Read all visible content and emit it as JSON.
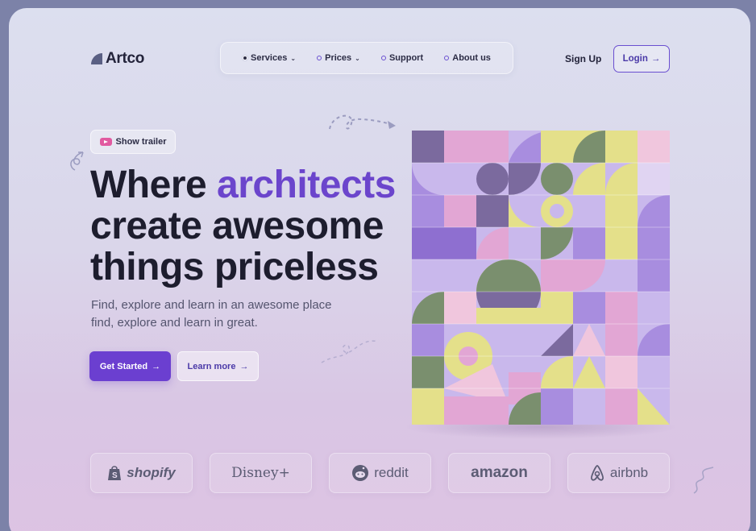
{
  "header": {
    "logo_text": "Artco",
    "nav": [
      {
        "label": "Services",
        "chevron": true
      },
      {
        "label": "Prices",
        "chevron": true
      },
      {
        "label": "Support",
        "chevron": false
      },
      {
        "label": "About us",
        "chevron": false
      }
    ],
    "signup_label": "Sign Up",
    "login_label": "Login",
    "login_arrow": "→"
  },
  "hero": {
    "trailer_label": "Show trailer",
    "headline_line1_a": "Where ",
    "headline_line1_accent": "architects",
    "headline_line2": "create awesome",
    "headline_line3": "things priceless",
    "subtitle_line1": "Find, explore and learn in an awesome place",
    "subtitle_line2": "find, explore and learn in great.",
    "primary_label": "Get Started",
    "secondary_label": "Learn more",
    "arrow": "→"
  },
  "brands": [
    "shopify",
    "Disney+",
    "reddit",
    "amazon",
    "airbnb"
  ],
  "colors": {
    "accent": "#6b45cc",
    "primary_button": "#6b3fd0",
    "heading": "#1d1d2e",
    "art_palette": [
      "#a88ddf",
      "#e2a6d4",
      "#e4e08a",
      "#7b6a9e",
      "#c9b8ec",
      "#7a8f6e",
      "#f0c6dd"
    ]
  },
  "icons": [
    "youtube-play-icon",
    "chevron-down-icon",
    "arrow-right-icon",
    "shopify-bag-icon",
    "reddit-alien-icon",
    "airbnb-icon"
  ]
}
